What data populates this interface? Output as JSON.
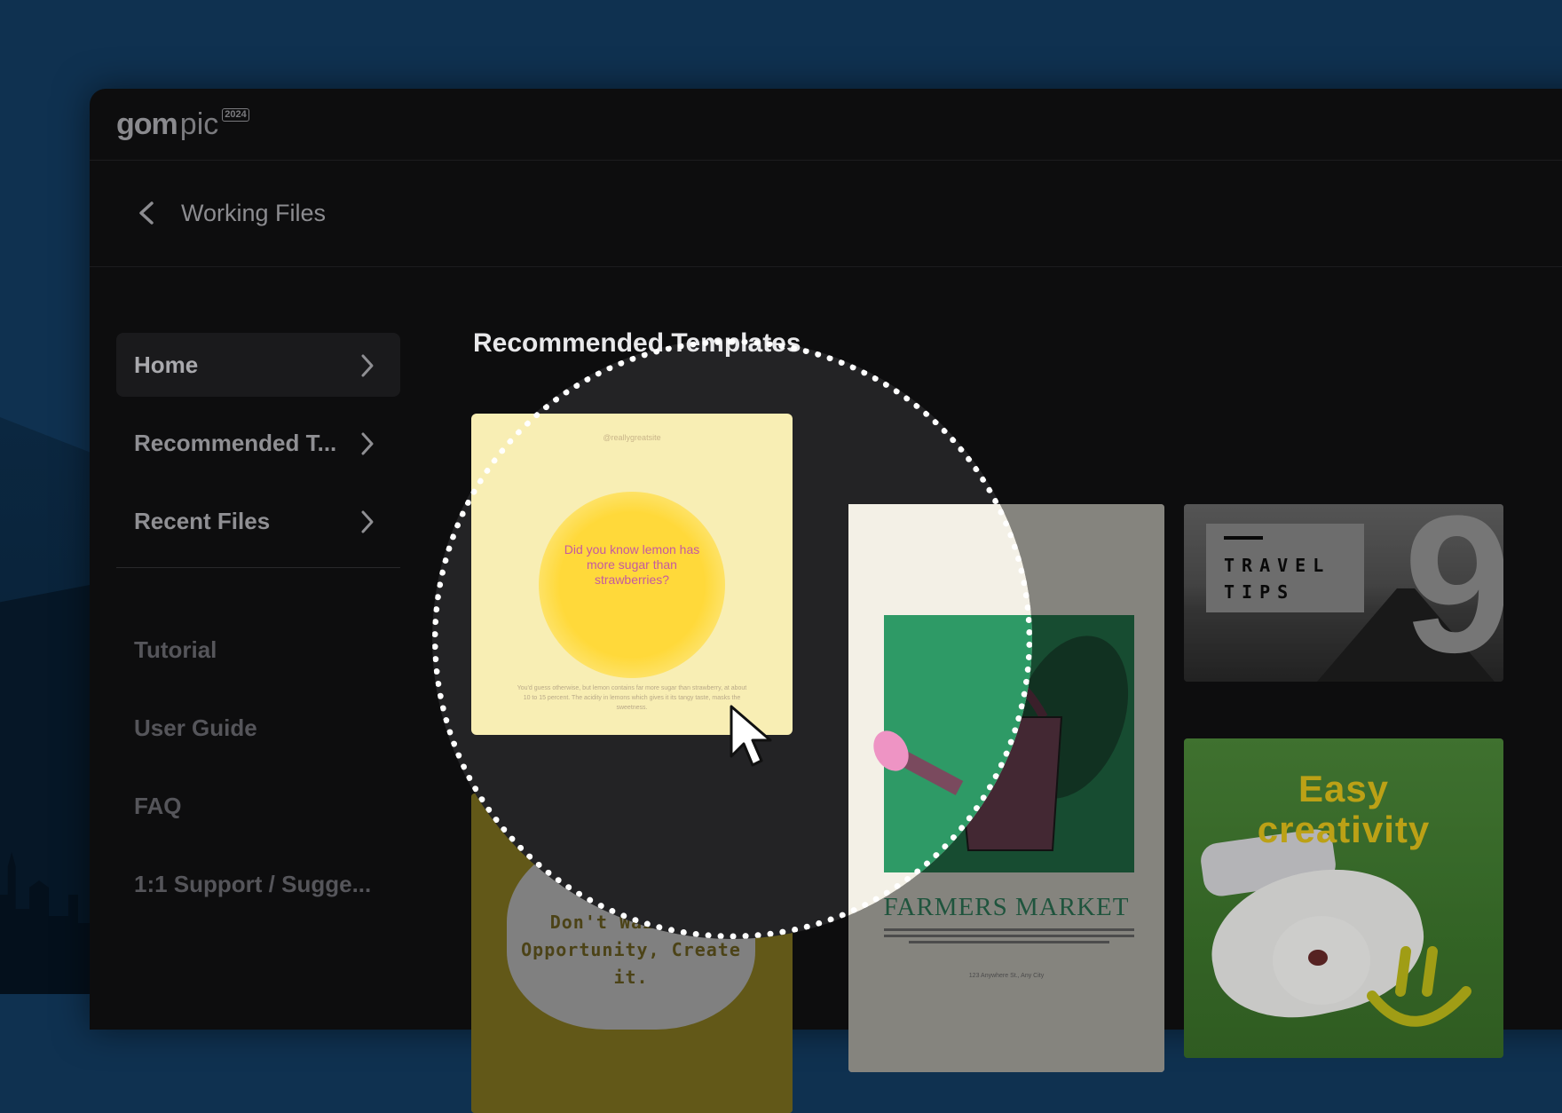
{
  "app": {
    "logo_brand": "gom",
    "logo_product": "pic",
    "logo_year": "2024"
  },
  "header": {
    "title": "Working Files"
  },
  "sidebar": {
    "nav": [
      {
        "label": "Home"
      },
      {
        "label": "Recommended T..."
      },
      {
        "label": "Recent Files"
      }
    ],
    "links": [
      {
        "label": "Tutorial"
      },
      {
        "label": "User Guide"
      },
      {
        "label": "FAQ"
      },
      {
        "label": "1:1 Support / Sugge..."
      }
    ]
  },
  "main": {
    "section_title": "Recommended Templates",
    "templates": {
      "lemon": {
        "handle": "@reallygreatsite",
        "headline": "Did you know lemon has more sugar than strawberries?",
        "body": "You'd guess otherwise, but lemon contains far more sugar than strawberry, at about 10 to 15 percent. The acidity in lemons which gives it its tangy taste, masks the sweetness."
      },
      "quote": {
        "text": "Don't Wait for Opportunity, Create it."
      },
      "farmers": {
        "title": "FARMERS MARKET",
        "footer": "123 Anywhere St., Any City"
      },
      "travel": {
        "text_line1": "TRAVEL",
        "text_line2": "TIPS",
        "number": "9"
      },
      "dog": {
        "title_line1": "Easy",
        "title_line2": "creativity"
      }
    }
  },
  "colors": {
    "desktop_bg": "#0f3150",
    "window_bg": "#0d0d0e",
    "spotlight_bg": "#232325",
    "accent_green": "#3a9a70",
    "accent_yellow": "#e6c51c"
  }
}
